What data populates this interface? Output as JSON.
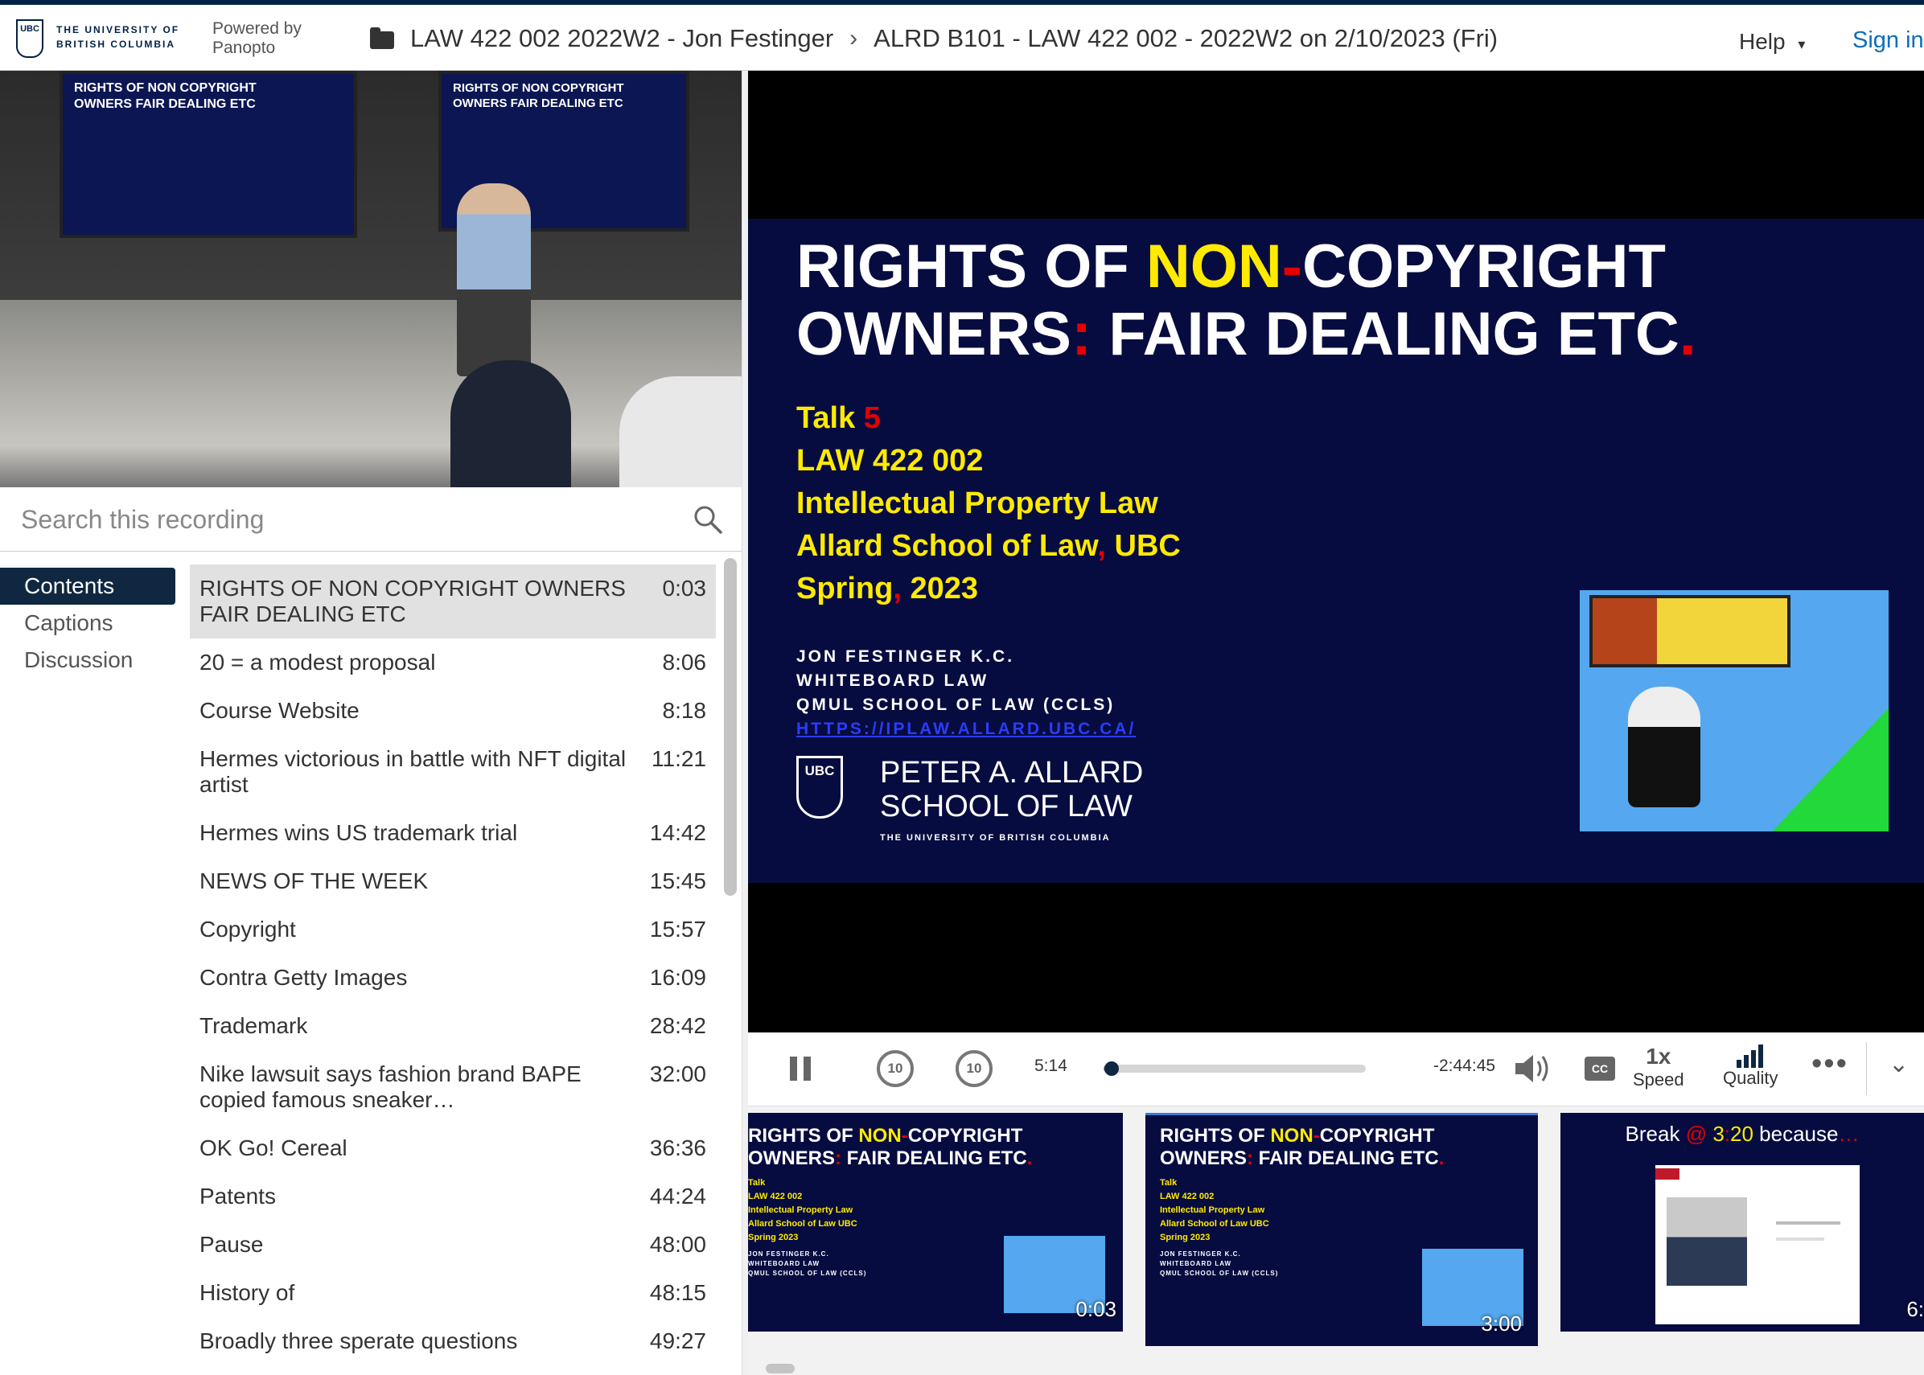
{
  "header": {
    "university": "THE UNIVERSITY OF BRITISH COLUMBIA",
    "powered": "Powered by Panopto",
    "crumb_folder": "LAW 422 002 2022W2 - Jon Festinger",
    "crumb_session": "ALRD B101 - LAW 422 002 - 2022W2 on 2/10/2023 (Fri)",
    "help": "Help",
    "signin": "Sign in"
  },
  "search": {
    "placeholder": "Search this recording"
  },
  "left_tabs": [
    "Contents",
    "Captions",
    "Discussion"
  ],
  "toc": [
    {
      "title": "RIGHTS OF NON COPYRIGHT OWNERS FAIR DEALING ETC",
      "time": "0:03"
    },
    {
      "title": "20 = a modest proposal",
      "time": "8:06"
    },
    {
      "title": "Course Website",
      "time": "8:18"
    },
    {
      "title": "Hermes victorious in battle with NFT digital artist",
      "time": "11:21"
    },
    {
      "title": "Hermes wins US trademark trial",
      "time": "14:42"
    },
    {
      "title": "NEWS OF THE WEEK",
      "time": "15:45"
    },
    {
      "title": "Copyright",
      "time": "15:57"
    },
    {
      "title": "Contra Getty Images",
      "time": "16:09"
    },
    {
      "title": "Trademark",
      "time": "28:42"
    },
    {
      "title": "Nike lawsuit says fashion brand BAPE copied famous sneaker…",
      "time": "32:00"
    },
    {
      "title": "OK Go! Cereal",
      "time": "36:36"
    },
    {
      "title": "Patents",
      "time": "44:24"
    },
    {
      "title": "Pause",
      "time": "48:00"
    },
    {
      "title": "History of",
      "time": "48:15"
    },
    {
      "title": "Broadly three sperate questions",
      "time": "49:27"
    }
  ],
  "slide": {
    "title_1a": "RIGHTS OF ",
    "title_1b": "NON",
    "title_1c": "-",
    "title_1d": "COPYRIGHT",
    "title_2a": "OWNERS",
    "title_2b": ":",
    "title_2c": " FAIR DEALING ETC",
    "title_2d": ".",
    "talk": "Talk",
    "talk_num": "5",
    "course": "LAW 422 002",
    "subject": "Intellectual Property Law",
    "school_a": "Allard School of Law",
    "school_b": ",",
    "school_c": " UBC",
    "term_a": "Spring",
    "term_b": ",",
    "term_c": " 2023",
    "author": "JON FESTINGER K.C.",
    "org1": "WHITEBOARD LAW",
    "org2": "QMUL SCHOOL OF LAW (CCLS)",
    "link": "HTTPS://IPLAW.ALLARD.UBC.CA/",
    "crest": "UBC",
    "school_name_1": "PETER A. ALLARD",
    "school_name_2": "SCHOOL OF LAW",
    "school_sub": "THE UNIVERSITY OF BRITISH COLUMBIA"
  },
  "controls": {
    "current_time": "5:14",
    "remaining": "-2:44:45",
    "progress_fraction": 0.031,
    "skip_back": "10",
    "skip_fwd": "10",
    "cc": "CC",
    "speed_value": "1x",
    "speed_label": "Speed",
    "quality_label": "Quality"
  },
  "thumbnails": [
    {
      "time": "0:03"
    },
    {
      "time": "3:00"
    },
    {
      "title_a": "Break ",
      "title_b": "@",
      "title_c": " 3",
      "title_d": ":",
      "title_e": "20",
      "title_f": " because",
      "title_g": "…",
      "time": "6:"
    }
  ]
}
